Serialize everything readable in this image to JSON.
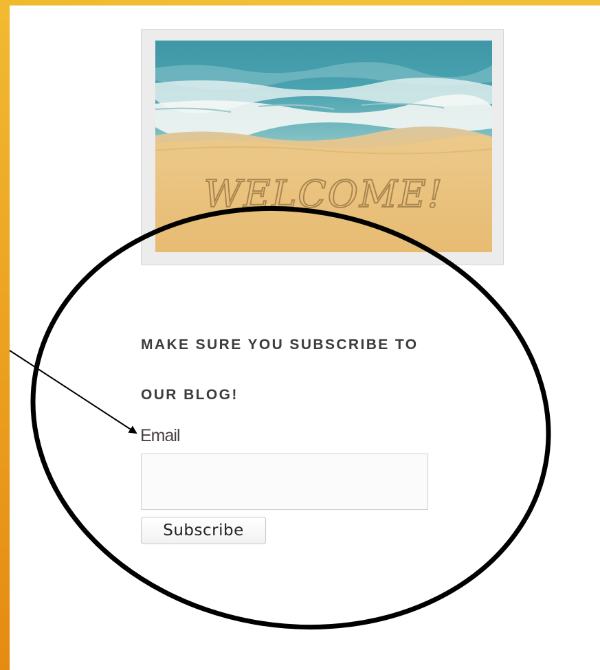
{
  "photo": {
    "alt": "Beach with WELCOME! written in the sand",
    "sand_text": "WELCOME!"
  },
  "subscribe": {
    "heading_line_1": "MAKE SURE YOU SUBSCRIBE TO",
    "heading_line_2": "OUR BLOG!",
    "email_label": "Email",
    "email_value": "",
    "button_label": "Subscribe"
  },
  "colors": {
    "frame_orange": "#eda422",
    "heading_text": "#3d3d3d",
    "annotation": "#000000"
  }
}
